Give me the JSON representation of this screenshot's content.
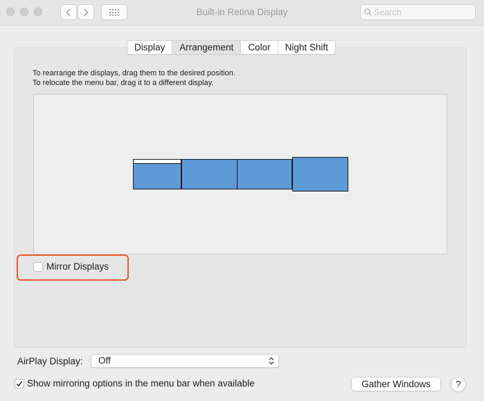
{
  "window": {
    "title": "Built-in Retina Display",
    "search_placeholder": "Search"
  },
  "tabs": [
    {
      "label": "Display",
      "active": false
    },
    {
      "label": "Arrangement",
      "active": true
    },
    {
      "label": "Color",
      "active": false
    },
    {
      "label": "Night Shift",
      "active": false
    }
  ],
  "arrangement": {
    "instruction_1": "To rearrange the displays, drag them to the desired position.",
    "instruction_2": "To relocate the menu bar, drag it to a different display.",
    "display_color": "#5e9ad7"
  },
  "mirror_displays": {
    "label": "Mirror Displays",
    "checked": false
  },
  "highlight_color": "#ea5a2c",
  "airplay": {
    "label": "AirPlay Display:",
    "value": "Off"
  },
  "show_mirroring": {
    "label": "Show mirroring options in the menu bar when available",
    "checked": true
  },
  "buttons": {
    "gather_windows": "Gather Windows",
    "help": "?"
  }
}
